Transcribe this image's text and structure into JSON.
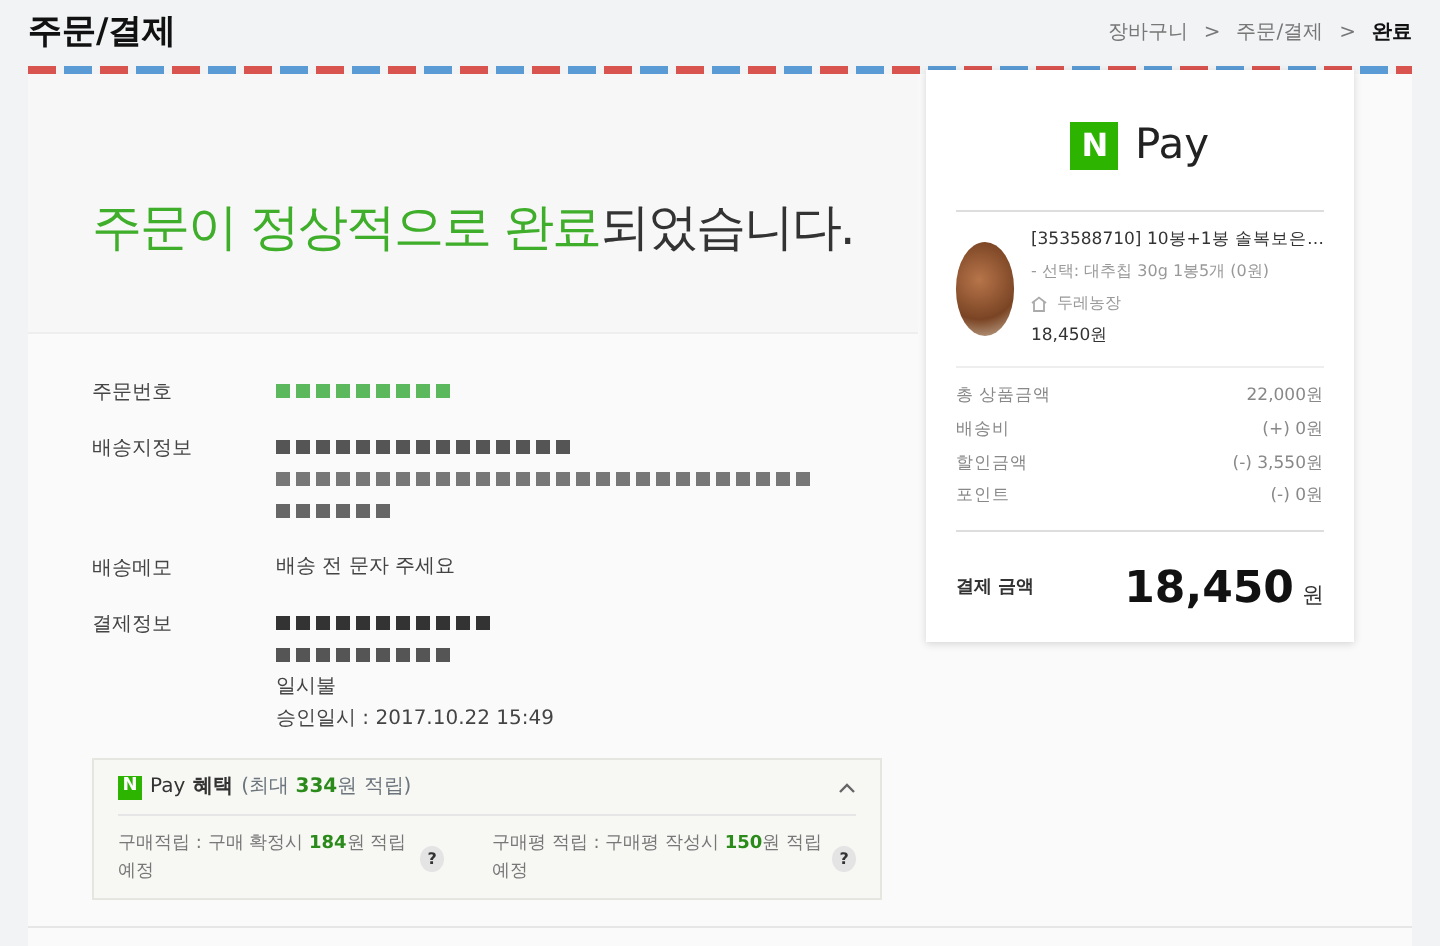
{
  "header": {
    "title": "주문/결제",
    "breadcrumb": [
      {
        "label": "장바구니",
        "selected": false
      },
      {
        "label": "주문/결제",
        "selected": false
      },
      {
        "label": "완료",
        "selected": true
      }
    ],
    "separator": ">"
  },
  "headline": {
    "highlight": "주문이 정상적으로 완료",
    "rest": "되었습니다."
  },
  "order_info": [
    {
      "label": "주문번호",
      "lines": [
        {
          "kind": "blurred",
          "color": "#5cb85c"
        }
      ]
    },
    {
      "label": "배송지정보",
      "lines": [
        {
          "kind": "blurred",
          "color": "#555555"
        },
        {
          "kind": "blurred",
          "color": "#777777"
        },
        {
          "kind": "blurred",
          "color": "#666666"
        }
      ]
    },
    {
      "label": "배송메모",
      "lines": [
        {
          "kind": "text",
          "text": "배송 전 문자 주세요"
        }
      ]
    },
    {
      "label": "결제정보",
      "lines": [
        {
          "kind": "blurred",
          "color": "#333333"
        },
        {
          "kind": "blurred",
          "color": "#555555"
        },
        {
          "kind": "text",
          "text": "일시불"
        },
        {
          "kind": "text",
          "text": "승인일시 : 2017.10.22 15:49"
        }
      ]
    }
  ],
  "benefits": {
    "logo_letter": "N",
    "logo_word": "Pay",
    "label": "혜택",
    "summary": "(최대 **334**원 적립)",
    "expanded": true,
    "items": [
      "구매적립 : 구매 확정시 **184**원 적립예정",
      "구매평 적립 : 구매평 작성시 **150**원 적립예정"
    ],
    "help": "?"
  },
  "receipt": {
    "logo_letter": "N",
    "logo_word": "Pay",
    "product": {
      "name": "[353588710] 10봉+1봉 솔복보은…",
      "option": "- 선택: 대추칩 30g 1봉5개 (0원)",
      "seller": "두레농장",
      "price": "18,450원"
    },
    "rows": [
      {
        "label": "총 상품금액",
        "value": "22,000원"
      },
      {
        "label": "배송비",
        "value": "(+) 0원"
      },
      {
        "label": "할인금액",
        "value": "(-) 3,550원"
      },
      {
        "label": "포인트",
        "value": "(-) 0원"
      }
    ],
    "total_label": "결제 금액",
    "total_value": "18,450",
    "total_unit": "원"
  }
}
